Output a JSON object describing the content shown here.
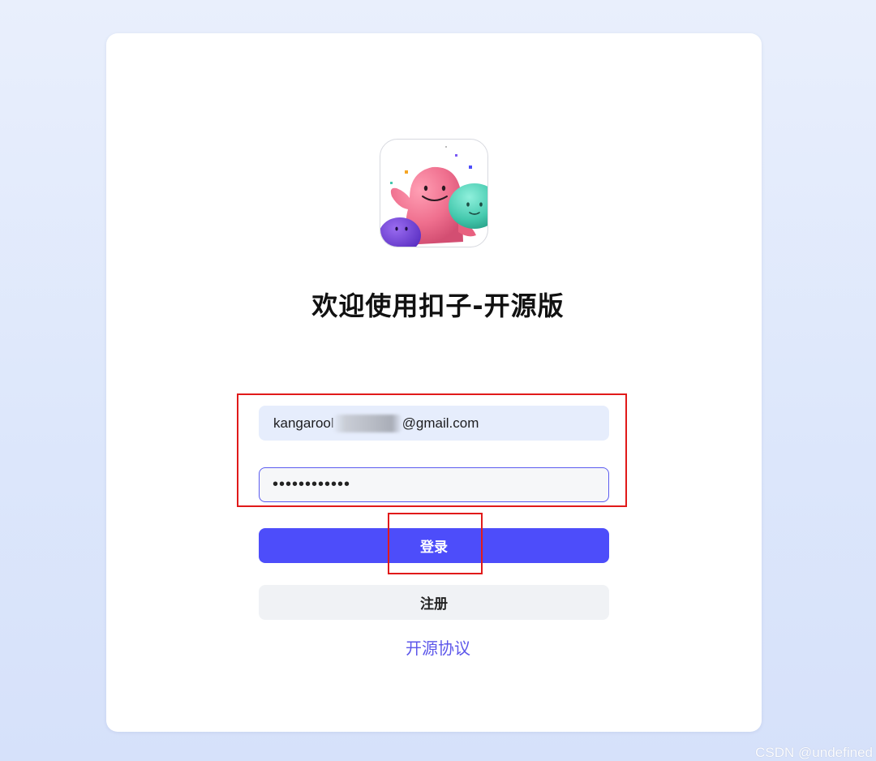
{
  "logo": {
    "icon": "coze-mascot-logo"
  },
  "title": "欢迎使用扣子-开源版",
  "login_form": {
    "email_prefix": "kangarool",
    "email_suffix": "@gmail.com",
    "password_value": "••••••••••••",
    "login_label": "登录",
    "register_label": "注册"
  },
  "license_link": "开源协议",
  "watermark": "CSDN @undefined",
  "colors": {
    "primary": "#4d4dfa",
    "link": "#5d57ea",
    "annotation": "#e11a1a"
  }
}
